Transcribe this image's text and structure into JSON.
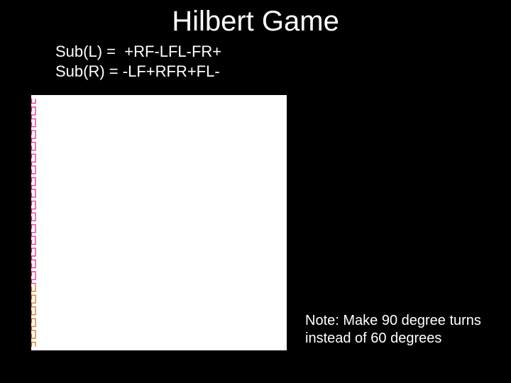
{
  "title": "Hilbert Game",
  "rules": {
    "line1": "Sub(L) =  +RF-LFL-FR+",
    "line2": "Sub(R) = -LF+RFR+FL-"
  },
  "note": "Note: Make 90 degree turns instead of 60 degrees",
  "hilbert": {
    "depth": 6,
    "size": 360,
    "colors": [
      "#e63c9c",
      "#6fbf3f",
      "#1fa5c8",
      "#9a4de0",
      "#e63c9c",
      "#f2e636",
      "#d87a2a",
      "#1fa5c8",
      "#e63c9c",
      "#f2e636",
      "#9a4de0",
      "#6fbf3f",
      "#d87a2a",
      "#e63c9c",
      "#1fa5c8",
      "#e63c9c"
    ]
  }
}
